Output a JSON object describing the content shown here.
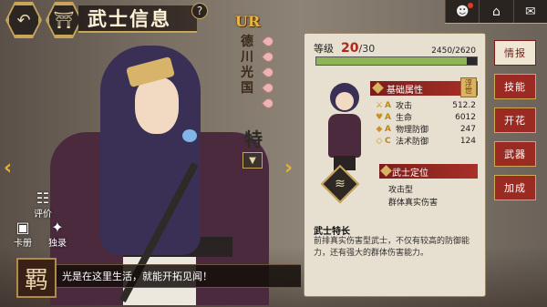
{
  "header": {
    "title": "武士信息",
    "help_label": "?",
    "back_icon": "back-arrow-icon",
    "home_icon": "shrine-home-icon"
  },
  "top_right": {
    "buttons": [
      "avatar-icon",
      "home-up-icon",
      "mail-icon"
    ],
    "avatar_glyph": "☻",
    "home_glyph": "⌂",
    "mail_glyph": "✉"
  },
  "character": {
    "rarity": "UR",
    "name_chars": [
      "德",
      "川",
      "光",
      "国"
    ],
    "kanji": "特",
    "quote": "光是在这里生活，就能开拓见闻！",
    "stamp": "羁"
  },
  "side_buttons": [
    {
      "label": "评价",
      "icon": "rating-icon",
      "glyph": "☷"
    },
    {
      "label": "卡册",
      "icon": "card-album-icon",
      "glyph": "▣"
    },
    {
      "label": "独录",
      "icon": "record-icon",
      "glyph": "✦"
    }
  ],
  "panel": {
    "level_label": "等级",
    "level_current": "20",
    "level_max": "/30",
    "xp_text": "2450/2620",
    "xp_fraction": 0.935,
    "attr_title": "基础属性",
    "attr_badge": "浮 世",
    "stats": [
      {
        "icon": "attack-icon",
        "glyph": "⚔",
        "grade": "A",
        "name": "攻击",
        "value": "512.2"
      },
      {
        "icon": "hp-icon",
        "glyph": "♥",
        "grade": "A",
        "name": "生命",
        "value": "6012"
      },
      {
        "icon": "pdef-icon",
        "glyph": "◆",
        "grade": "A",
        "name": "物理防御",
        "value": "247"
      },
      {
        "icon": "mdef-icon",
        "glyph": "◇",
        "grade": "C",
        "name": "法术防御",
        "value": "124"
      }
    ],
    "position_title": "武士定位",
    "position_lines": [
      "攻击型",
      "群体真实伤害"
    ],
    "specialty_title": "武士特长",
    "specialty_text": "前排真实伤害型武士，不仅有较高的防御能力，还有强大的群体伤害能力。"
  },
  "tabs": [
    {
      "label": "情报",
      "active": true
    },
    {
      "label": "技能",
      "active": false
    },
    {
      "label": "开花",
      "active": false
    },
    {
      "label": "武器",
      "active": false
    },
    {
      "label": "加成",
      "active": false
    }
  ],
  "nav": {
    "left": "‹",
    "right": "›"
  },
  "colors": {
    "accent_gold": "#c9a55b",
    "tab_red": "#9a2a22",
    "level_red": "#b2261c",
    "xp_green": "#8fb458"
  }
}
